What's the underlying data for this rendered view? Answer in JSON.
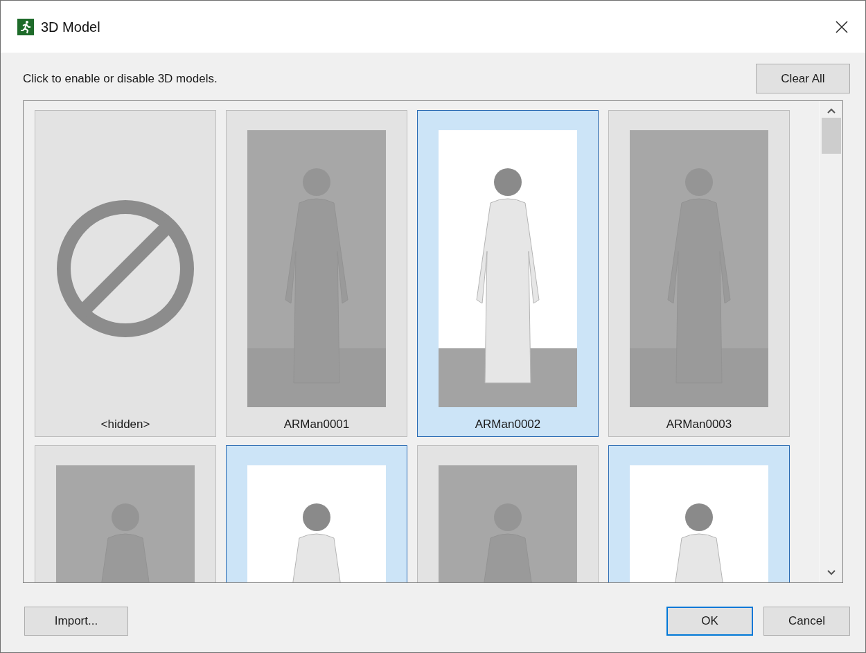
{
  "window": {
    "title": "3D Model"
  },
  "instruction": "Click to enable or disable 3D models.",
  "clear_all": "Clear All",
  "models": [
    {
      "kind": "hidden",
      "label": "<hidden>",
      "selected": false
    },
    {
      "kind": "model",
      "label": "ARMan0001",
      "selected": false
    },
    {
      "kind": "model",
      "label": "ARMan0002",
      "selected": true
    },
    {
      "kind": "model",
      "label": "ARMan0003",
      "selected": false
    },
    {
      "kind": "model",
      "selected": false
    },
    {
      "kind": "model",
      "selected": true
    },
    {
      "kind": "model",
      "selected": false
    },
    {
      "kind": "model",
      "selected": true
    }
  ],
  "buttons": {
    "import": "Import...",
    "ok": "OK",
    "cancel": "Cancel"
  }
}
